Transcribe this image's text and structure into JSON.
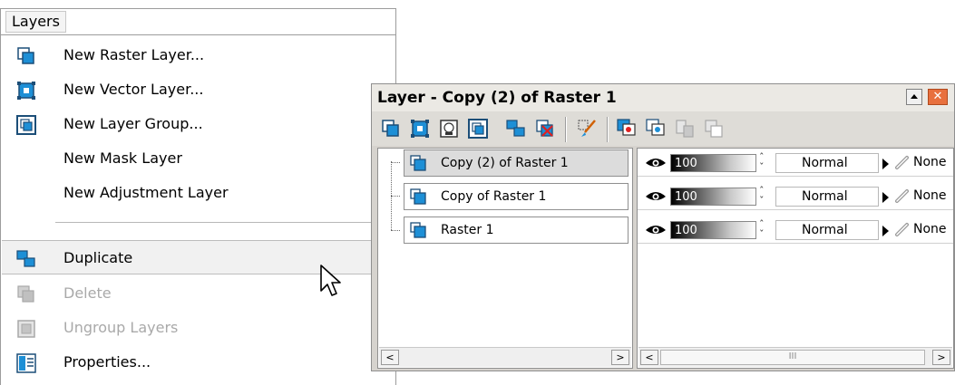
{
  "menu": {
    "title": "Layers",
    "items": [
      {
        "label": "New Raster Layer...",
        "icon": "new-raster-layer-icon",
        "disabled": false
      },
      {
        "label": "New Vector Layer...",
        "icon": "new-vector-layer-icon",
        "disabled": false
      },
      {
        "label": "New Layer Group...",
        "icon": "new-layer-group-icon",
        "disabled": false
      },
      {
        "label": "New Mask Layer",
        "icon": "",
        "disabled": false
      },
      {
        "label": "New Adjustment Layer",
        "icon": "",
        "disabled": false
      },
      {
        "label": "Duplicate",
        "icon": "duplicate-icon",
        "disabled": false,
        "highlighted": true
      },
      {
        "label": "Delete",
        "icon": "delete-icon",
        "disabled": true
      },
      {
        "label": "Ungroup Layers",
        "icon": "ungroup-icon",
        "disabled": true
      },
      {
        "label": "Properties...",
        "icon": "properties-icon",
        "disabled": false
      }
    ]
  },
  "palette": {
    "title": "Layer - Copy (2) of Raster 1",
    "toolbar_icons": [
      "new-raster-layer-icon",
      "new-vector-layer-icon",
      "new-mask-icon",
      "new-layer-group-icon",
      "duplicate-icon",
      "delete-icon",
      "edit-brush-icon",
      "view-icon",
      "link-icon",
      "merge-icon",
      "lock-icon"
    ],
    "layers": [
      {
        "name": "Copy (2) of Raster 1",
        "selected": true,
        "opacity": "100",
        "blend": "Normal",
        "link": "None"
      },
      {
        "name": "Copy of Raster 1",
        "selected": false,
        "opacity": "100",
        "blend": "Normal",
        "link": "None"
      },
      {
        "name": "Raster 1",
        "selected": false,
        "opacity": "100",
        "blend": "Normal",
        "link": "None"
      }
    ],
    "scroll_thumb_grip": "III"
  },
  "colors": {
    "layer_icon_blue": "#1d8fd6",
    "layer_icon_dark": "#1c4e78"
  }
}
